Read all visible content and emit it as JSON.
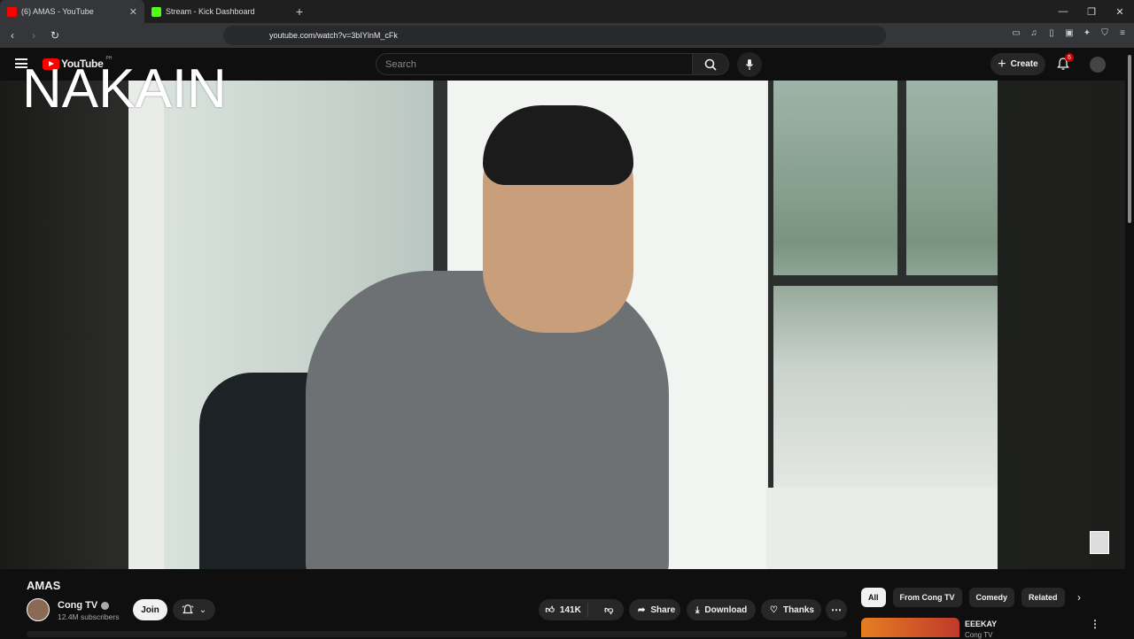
{
  "browser": {
    "tabs": [
      {
        "title": "(6) AMAS - YouTube",
        "active": true,
        "favicon_color": "#ff0000"
      },
      {
        "title": "Stream - Kick Dashboard",
        "active": false,
        "favicon_color": "#53fc18"
      }
    ],
    "new_tab": "+",
    "address": "youtube.com/watch?v=3bIYlnM_cFk"
  },
  "youtube": {
    "logo": "YouTube",
    "country": "PH",
    "search_placeholder": "Search",
    "create_label": "Create",
    "notification_count": "6"
  },
  "video": {
    "overlay_caption": "NAKAIN",
    "title": "AMAS"
  },
  "channel": {
    "name": "Cong TV",
    "subscribers": "12.4M subscribers",
    "join_label": "Join"
  },
  "actions": {
    "likes": "141K",
    "share": "Share",
    "download": "Download",
    "thanks": "Thanks"
  },
  "chips": [
    "All",
    "From Cong TV",
    "Comedy",
    "Related"
  ],
  "recommendation": {
    "title": "EEEKAY",
    "channel": "Cong TV"
  },
  "colors": {
    "brand_red": "#ff0000",
    "background": "#0f0f0f"
  }
}
